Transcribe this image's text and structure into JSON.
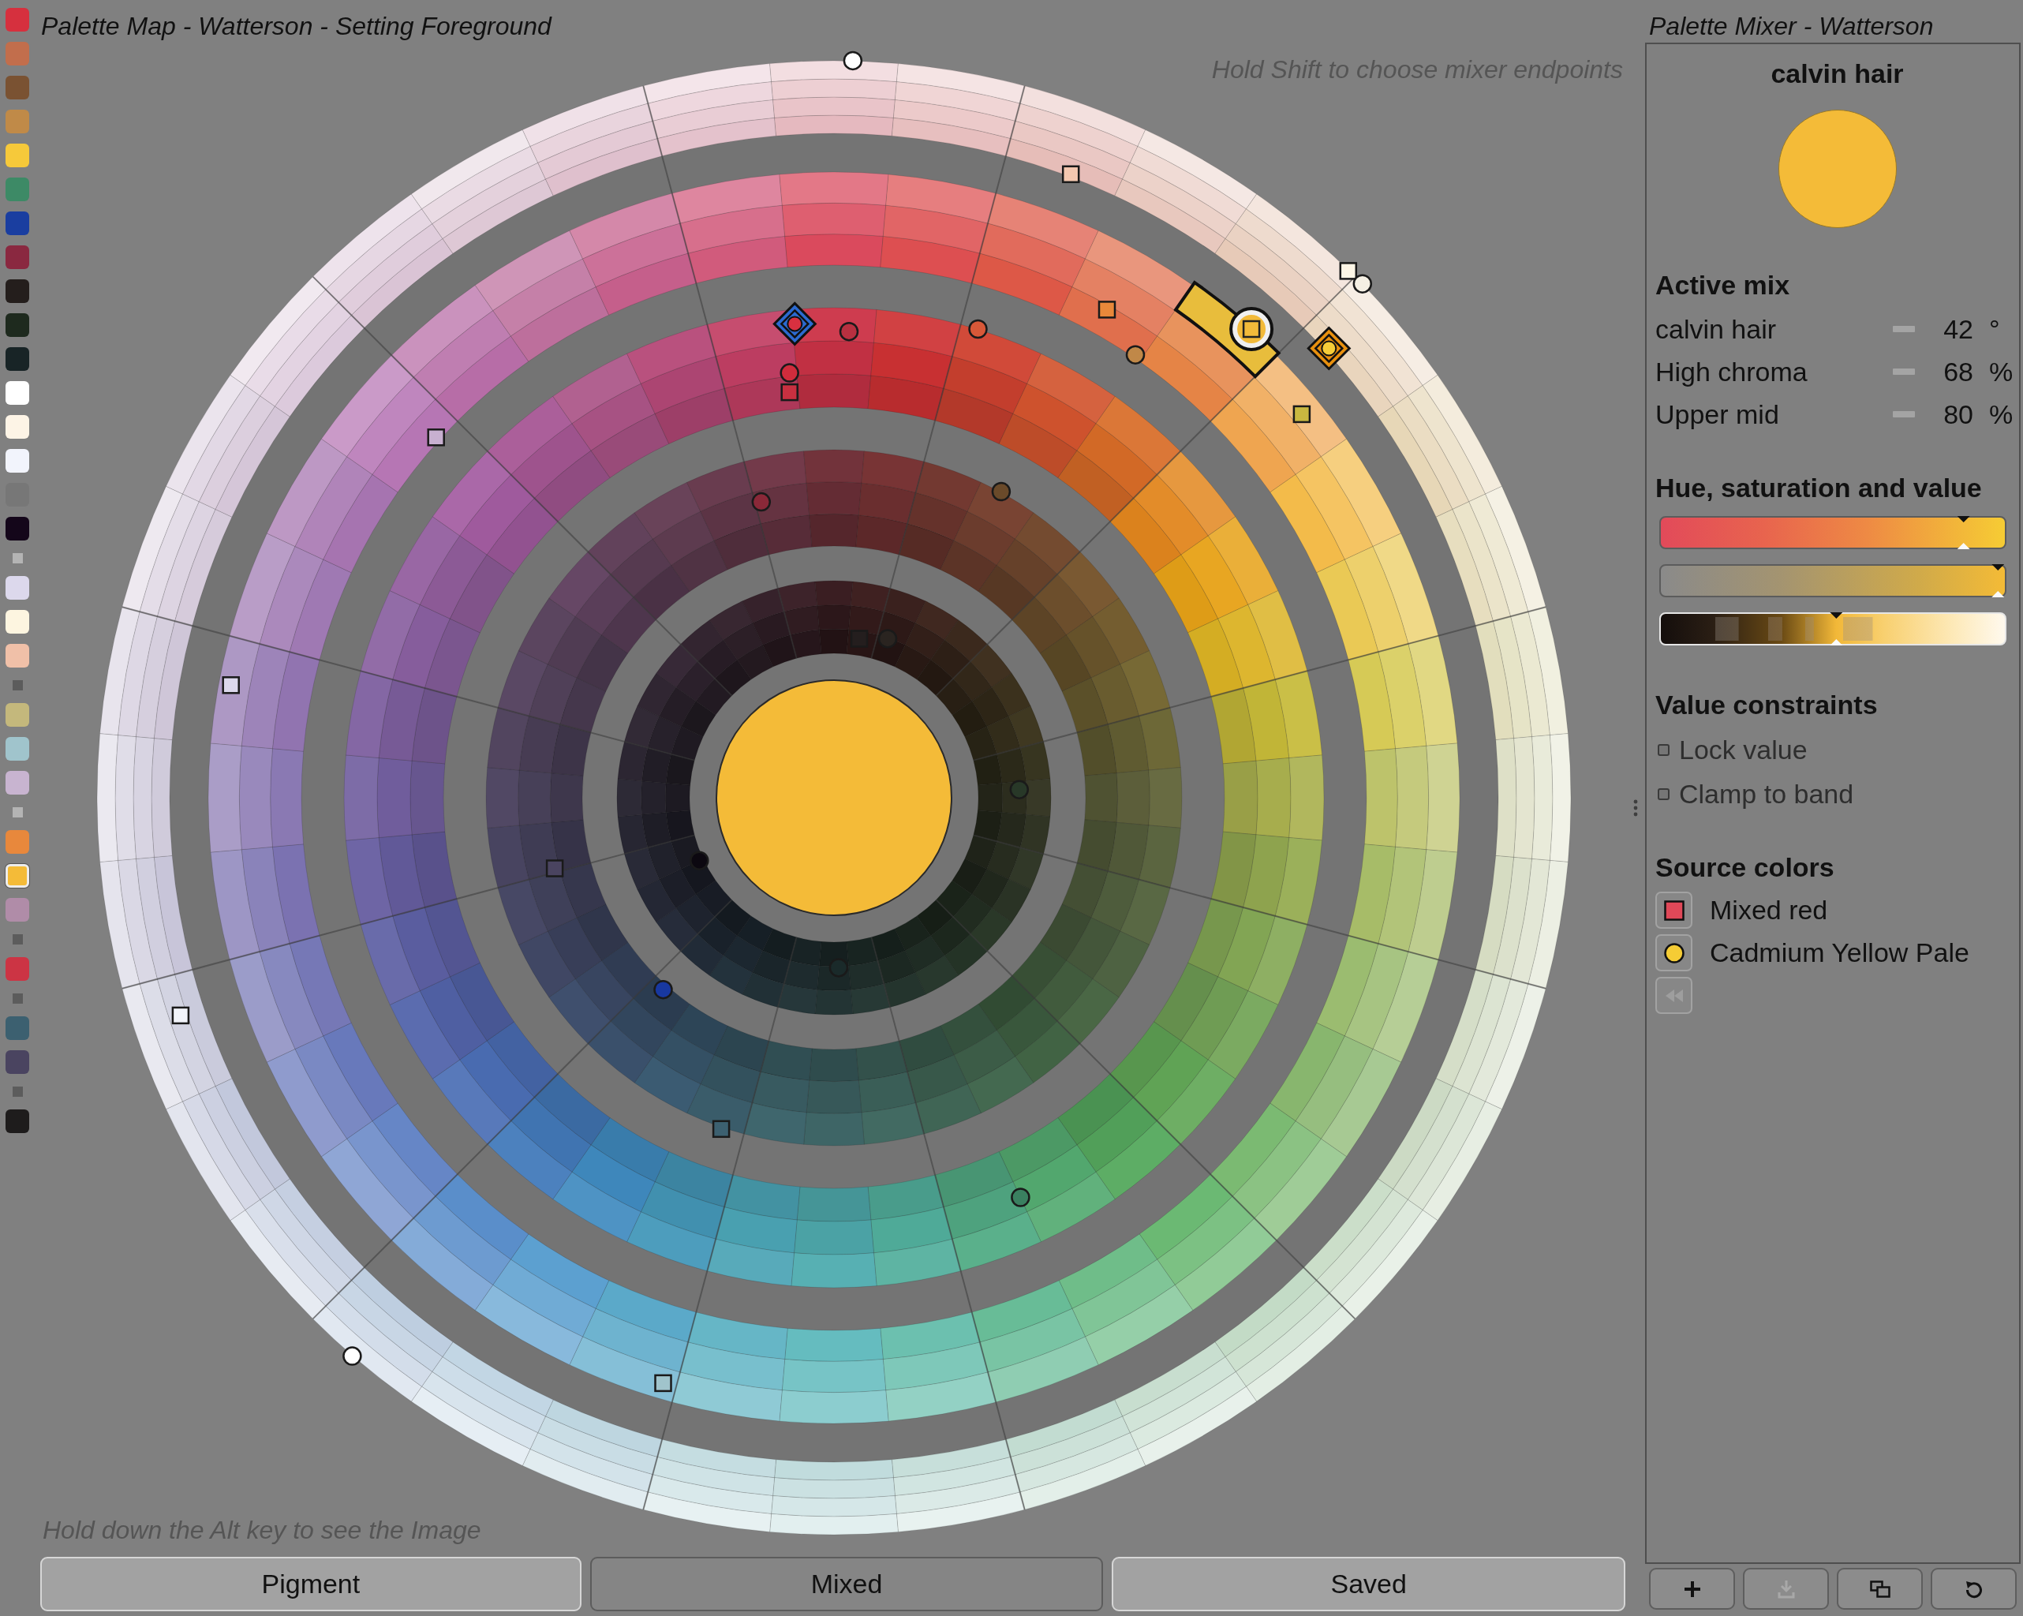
{
  "palette_swatches": [
    {
      "kind": "swatch",
      "color": "#d6303e",
      "selected": false
    },
    {
      "kind": "swatch",
      "color": "#c26e4c",
      "selected": false
    },
    {
      "kind": "swatch",
      "color": "#7a5232",
      "selected": false
    },
    {
      "kind": "swatch",
      "color": "#c08a48",
      "selected": false
    },
    {
      "kind": "swatch",
      "color": "#f6c93a",
      "selected": false
    },
    {
      "kind": "swatch",
      "color": "#3d8a66",
      "selected": false
    },
    {
      "kind": "swatch",
      "color": "#1a3ea0",
      "selected": false
    },
    {
      "kind": "swatch",
      "color": "#8a2840",
      "selected": false
    },
    {
      "kind": "swatch",
      "color": "#241e1c",
      "selected": false
    },
    {
      "kind": "swatch",
      "color": "#1e2a1e",
      "selected": false
    },
    {
      "kind": "swatch",
      "color": "#182426",
      "selected": false
    },
    {
      "kind": "swatch",
      "color": "#ffffff",
      "selected": false
    },
    {
      "kind": "swatch",
      "color": "#fdf4e6",
      "selected": false
    },
    {
      "kind": "swatch",
      "color": "#f2f4fc",
      "selected": false
    },
    {
      "kind": "swatch",
      "color": "#777777",
      "selected": false
    },
    {
      "kind": "swatch",
      "color": "#14061a",
      "selected": false
    },
    {
      "kind": "separator",
      "color": "#b4b4b4"
    },
    {
      "kind": "swatch",
      "color": "#dcd8ec",
      "selected": false
    },
    {
      "kind": "swatch",
      "color": "#fdf5e0",
      "selected": false
    },
    {
      "kind": "swatch",
      "color": "#f0c0a8",
      "selected": false
    },
    {
      "kind": "separator",
      "color": "#5c5c5c"
    },
    {
      "kind": "swatch",
      "color": "#c4b87c",
      "selected": false
    },
    {
      "kind": "swatch",
      "color": "#a0c4cc",
      "selected": false
    },
    {
      "kind": "swatch",
      "color": "#c8b4d0",
      "selected": false
    },
    {
      "kind": "separator",
      "color": "#b4b4b4"
    },
    {
      "kind": "swatch",
      "color": "#e8883c",
      "selected": false
    },
    {
      "kind": "swatch",
      "color": "#f4bb38",
      "selected": true
    },
    {
      "kind": "swatch",
      "color": "#b08ca8",
      "selected": false
    },
    {
      "kind": "separator",
      "color": "#5c5c5c"
    },
    {
      "kind": "swatch",
      "color": "#cc3444",
      "selected": false
    },
    {
      "kind": "separator",
      "color": "#5c5c5c"
    },
    {
      "kind": "swatch",
      "color": "#3c6070",
      "selected": false
    },
    {
      "kind": "swatch",
      "color": "#4a4460",
      "selected": false
    },
    {
      "kind": "separator",
      "color": "#5c5c5c"
    },
    {
      "kind": "swatch",
      "color": "#1e1c1c",
      "selected": false
    }
  ],
  "map": {
    "title": "Palette Map - Watterson - Setting Foreground",
    "hint": "Hold Shift to choose mixer endpoints",
    "footer_hint": "Hold down the Alt key to see the Image"
  },
  "tabs": [
    {
      "label": "Pigment",
      "selected": false
    },
    {
      "label": "Mixed",
      "selected": true
    },
    {
      "label": "Saved",
      "selected": false
    }
  ],
  "mixer": {
    "title": "Palette Mixer - Watterson",
    "color_name": "calvin hair",
    "active_mix": {
      "heading": "Active mix",
      "rows": [
        {
          "label": "calvin hair",
          "value": "42",
          "unit": "°"
        },
        {
          "label": "High chroma",
          "value": "68",
          "unit": "%"
        },
        {
          "label": "Upper mid",
          "value": "80",
          "unit": "%"
        }
      ]
    },
    "hsv": {
      "heading": "Hue, saturation and value",
      "sliders": [
        {
          "kind": "hue",
          "level": 0.88
        },
        {
          "kind": "saturation",
          "level": 0.98
        },
        {
          "kind": "value",
          "level": 0.51
        }
      ]
    },
    "constraints": {
      "heading": "Value constraints",
      "options": [
        {
          "label": "Lock value",
          "checked": false
        },
        {
          "label": "Clamp to band",
          "checked": false
        }
      ]
    },
    "sources": {
      "heading": "Source colors",
      "items": [
        {
          "label": "Mixed red",
          "kind": "square",
          "color": "#e04858"
        },
        {
          "label": "Cadmium Yellow Pale",
          "kind": "circle",
          "color": "#f5cc35"
        }
      ],
      "back_button": {
        "disabled": true
      }
    },
    "toolbar": [
      {
        "kind": "add",
        "disabled": false
      },
      {
        "kind": "download",
        "disabled": true
      },
      {
        "kind": "windows",
        "disabled": false
      },
      {
        "kind": "undo",
        "disabled": false
      }
    ]
  }
}
